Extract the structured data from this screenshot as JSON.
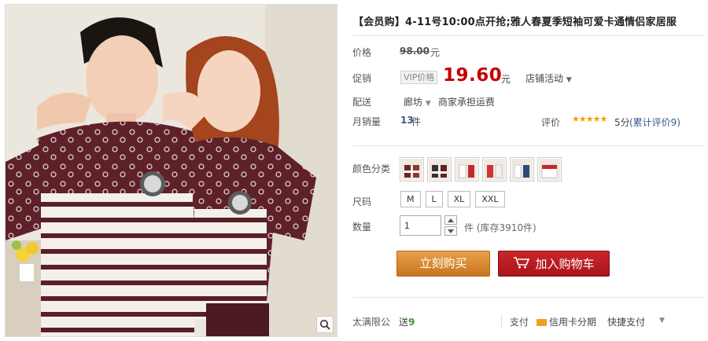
{
  "product": {
    "title": "【会员购】4-11号10:00点开抢;雅人春夏季短袖可爱卡通情侣家居服",
    "image_alt": "couple wearing matching striped pajama tees"
  },
  "price_block": {
    "price_label": "价格",
    "original_price": "98.00",
    "currency_unit": "元",
    "promo_label": "促销",
    "vip_tag": "VIP价格",
    "promo_price": "19.60",
    "promo_currency": "元",
    "shop_activity": "店铺活动",
    "shipping_label": "配送",
    "ship_city": "廊坊",
    "ship_note": "商家承担运费",
    "monthly_sales_label": "月销量",
    "monthly_sales": "13",
    "monthly_sales_unit": "件",
    "rating_label": "评价",
    "stars": "★★★★★",
    "rating_score": "5分",
    "rating_count": "(累计评价9)"
  },
  "options": {
    "color_label": "颜色分类",
    "size_label": "尺码",
    "sizes": [
      "M",
      "L",
      "XL",
      "XXL"
    ],
    "quantity_label": "数量",
    "quantity_value": "1",
    "stock_text": "件 (库存3910件)"
  },
  "actions": {
    "buy_now": "立刻购买",
    "add_to_cart": "加入购物车"
  },
  "footer": {
    "gift_label": "太满限公",
    "gift_prefix": "送",
    "gift_value": "9",
    "pay_label": "支付",
    "pay_option_1": "信用卡分期",
    "pay_option_2": "快捷支付"
  },
  "colors": {
    "price_red": "#c40000",
    "buy_orange": "#d88a36",
    "cart_red": "#b81c22",
    "link_blue": "#3a5a8c"
  }
}
